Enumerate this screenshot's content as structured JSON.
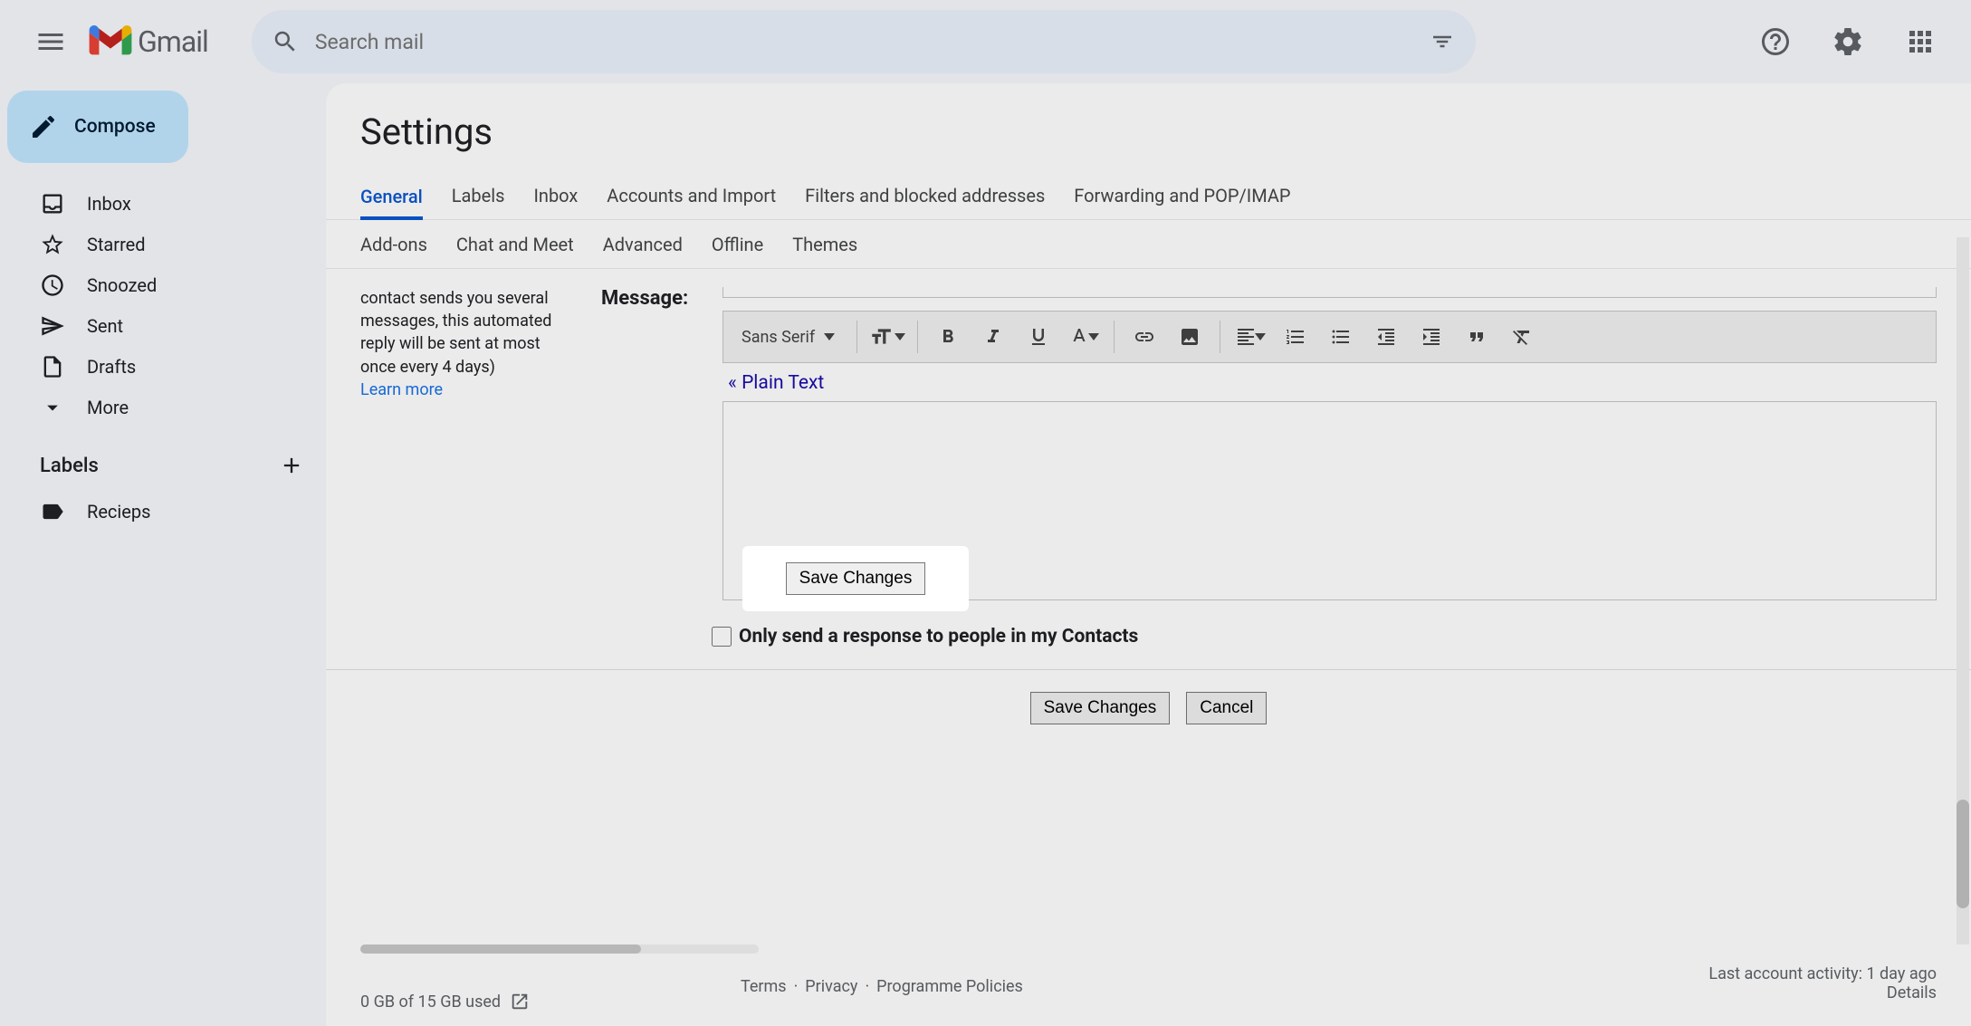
{
  "header": {
    "search_placeholder": "Search mail",
    "logo_text": "Gmail"
  },
  "sidebar": {
    "compose": "Compose",
    "items": [
      {
        "label": "Inbox",
        "icon": "inbox"
      },
      {
        "label": "Starred",
        "icon": "star"
      },
      {
        "label": "Snoozed",
        "icon": "clock"
      },
      {
        "label": "Sent",
        "icon": "send"
      },
      {
        "label": "Drafts",
        "icon": "draft"
      },
      {
        "label": "More",
        "icon": "more"
      }
    ],
    "labels_header": "Labels",
    "labels": [
      {
        "label": "Recieps"
      }
    ]
  },
  "content": {
    "title": "Settings",
    "tabs1": [
      "General",
      "Labels",
      "Inbox",
      "Accounts and Import",
      "Filters and blocked addresses",
      "Forwarding and POP/IMAP"
    ],
    "tabs2": [
      "Add-ons",
      "Chat and Meet",
      "Advanced",
      "Offline",
      "Themes"
    ],
    "active_tab": "General",
    "desc_text": "contact sends you several messages, this automated reply will be sent at most once every 4 days)",
    "learn_more": "Learn more",
    "message_label": "Message:",
    "font_name": "Sans Serif",
    "plain_text": "« Plain Text",
    "checkbox_label": "Only send a response to people in my Contacts",
    "save": "Save Changes",
    "cancel": "Cancel"
  },
  "footer": {
    "storage": "0 GB of 15 GB used",
    "links": [
      "Terms",
      "Privacy",
      "Programme Policies"
    ],
    "sep": " · ",
    "activity": "Last account activity: 1 day ago",
    "details": "Details"
  }
}
